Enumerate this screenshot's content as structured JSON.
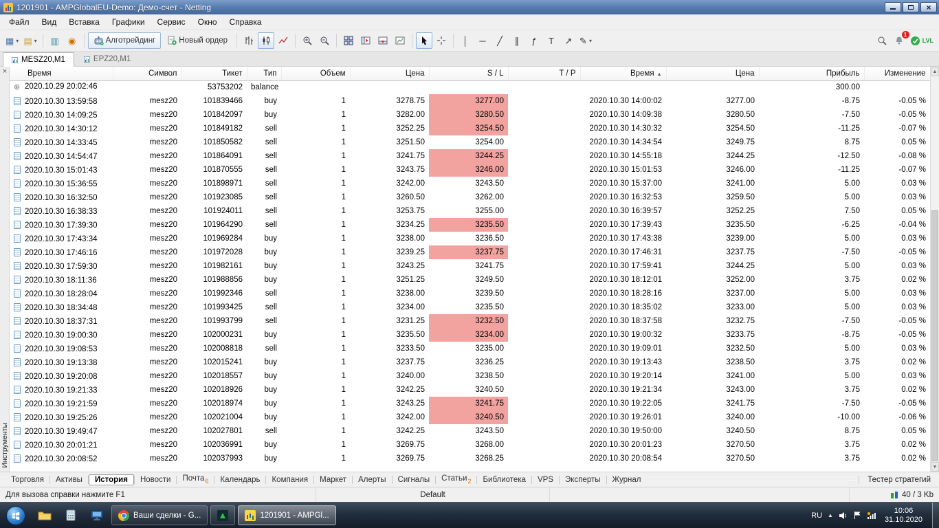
{
  "window": {
    "title": "1201901 - AMPGlobalEU-Demo: Демо-счет - Netting"
  },
  "menubar": {
    "items": [
      "Файл",
      "Вид",
      "Вставка",
      "Графики",
      "Сервис",
      "Окно",
      "Справка"
    ]
  },
  "toolbar": {
    "algo_trading_label": "Алготрейдинг",
    "new_order_label": "Новый ордер",
    "notifications_badge": "1",
    "community_label": "LVL"
  },
  "chart_tabs": {
    "active_index": 0,
    "tabs": [
      {
        "label": "MESZ20,M1"
      },
      {
        "label": "EPZ20,M1"
      }
    ]
  },
  "history": {
    "columns": [
      "Время",
      "Символ",
      "Тикет",
      "Тип",
      "Объем",
      "Цена",
      "S / L",
      "T / P",
      "Время",
      "Цена",
      "Прибыль",
      "Изменение"
    ],
    "sorted_column_index": 8,
    "rows": [
      {
        "t1": "2020.10.29 20:02:46",
        "sym": "",
        "ticket": "53753202",
        "type": "balance",
        "vol": "",
        "price": "",
        "sl": "",
        "slHit": false,
        "tp": "",
        "t2": "",
        "price2": "",
        "profit": "300.00",
        "change": ""
      },
      {
        "t1": "2020.10.30 13:59:58",
        "sym": "mesz20",
        "ticket": "101839466",
        "type": "buy",
        "vol": "1",
        "price": "3278.75",
        "sl": "3277.00",
        "slHit": true,
        "tp": "",
        "t2": "2020.10.30 14:00:02",
        "price2": "3277.00",
        "profit": "-8.75",
        "change": "-0.05 %"
      },
      {
        "t1": "2020.10.30 14:09:25",
        "sym": "mesz20",
        "ticket": "101842097",
        "type": "buy",
        "vol": "1",
        "price": "3282.00",
        "sl": "3280.50",
        "slHit": true,
        "tp": "",
        "t2": "2020.10.30 14:09:38",
        "price2": "3280.50",
        "profit": "-7.50",
        "change": "-0.05 %"
      },
      {
        "t1": "2020.10.30 14:30:12",
        "sym": "mesz20",
        "ticket": "101849182",
        "type": "sell",
        "vol": "1",
        "price": "3252.25",
        "sl": "3254.50",
        "slHit": true,
        "tp": "",
        "t2": "2020.10.30 14:30:32",
        "price2": "3254.50",
        "profit": "-11.25",
        "change": "-0.07 %"
      },
      {
        "t1": "2020.10.30 14:33:45",
        "sym": "mesz20",
        "ticket": "101850582",
        "type": "sell",
        "vol": "1",
        "price": "3251.50",
        "sl": "3254.00",
        "slHit": false,
        "tp": "",
        "t2": "2020.10.30 14:34:54",
        "price2": "3249.75",
        "profit": "8.75",
        "change": "0.05 %"
      },
      {
        "t1": "2020.10.30 14:54:47",
        "sym": "mesz20",
        "ticket": "101864091",
        "type": "sell",
        "vol": "1",
        "price": "3241.75",
        "sl": "3244.25",
        "slHit": true,
        "tp": "",
        "t2": "2020.10.30 14:55:18",
        "price2": "3244.25",
        "profit": "-12.50",
        "change": "-0.08 %"
      },
      {
        "t1": "2020.10.30 15:01:43",
        "sym": "mesz20",
        "ticket": "101870555",
        "type": "sell",
        "vol": "1",
        "price": "3243.75",
        "sl": "3246.00",
        "slHit": true,
        "tp": "",
        "t2": "2020.10.30 15:01:53",
        "price2": "3246.00",
        "profit": "-11.25",
        "change": "-0.07 %"
      },
      {
        "t1": "2020.10.30 15:36:55",
        "sym": "mesz20",
        "ticket": "101898971",
        "type": "sell",
        "vol": "1",
        "price": "3242.00",
        "sl": "3243.50",
        "slHit": false,
        "tp": "",
        "t2": "2020.10.30 15:37:00",
        "price2": "3241.00",
        "profit": "5.00",
        "change": "0.03 %"
      },
      {
        "t1": "2020.10.30 16:32:50",
        "sym": "mesz20",
        "ticket": "101923085",
        "type": "sell",
        "vol": "1",
        "price": "3260.50",
        "sl": "3262.00",
        "slHit": false,
        "tp": "",
        "t2": "2020.10.30 16:32:53",
        "price2": "3259.50",
        "profit": "5.00",
        "change": "0.03 %"
      },
      {
        "t1": "2020.10.30 16:38:33",
        "sym": "mesz20",
        "ticket": "101924011",
        "type": "sell",
        "vol": "1",
        "price": "3253.75",
        "sl": "3255.00",
        "slHit": false,
        "tp": "",
        "t2": "2020.10.30 16:39:57",
        "price2": "3252.25",
        "profit": "7.50",
        "change": "0.05 %"
      },
      {
        "t1": "2020.10.30 17:39:30",
        "sym": "mesz20",
        "ticket": "101964290",
        "type": "sell",
        "vol": "1",
        "price": "3234.25",
        "sl": "3235.50",
        "slHit": true,
        "tp": "",
        "t2": "2020.10.30 17:39:43",
        "price2": "3235.50",
        "profit": "-6.25",
        "change": "-0.04 %"
      },
      {
        "t1": "2020.10.30 17:43:34",
        "sym": "mesz20",
        "ticket": "101969284",
        "type": "buy",
        "vol": "1",
        "price": "3238.00",
        "sl": "3236.50",
        "slHit": false,
        "tp": "",
        "t2": "2020.10.30 17:43:38",
        "price2": "3239.00",
        "profit": "5.00",
        "change": "0.03 %"
      },
      {
        "t1": "2020.10.30 17:46:16",
        "sym": "mesz20",
        "ticket": "101972028",
        "type": "buy",
        "vol": "1",
        "price": "3239.25",
        "sl": "3237.75",
        "slHit": true,
        "tp": "",
        "t2": "2020.10.30 17:46:31",
        "price2": "3237.75",
        "profit": "-7.50",
        "change": "-0.05 %"
      },
      {
        "t1": "2020.10.30 17:59:30",
        "sym": "mesz20",
        "ticket": "101982161",
        "type": "buy",
        "vol": "1",
        "price": "3243.25",
        "sl": "3241.75",
        "slHit": false,
        "tp": "",
        "t2": "2020.10.30 17:59:41",
        "price2": "3244.25",
        "profit": "5.00",
        "change": "0.03 %"
      },
      {
        "t1": "2020.10.30 18:11:36",
        "sym": "mesz20",
        "ticket": "101988856",
        "type": "buy",
        "vol": "1",
        "price": "3251.25",
        "sl": "3249.50",
        "slHit": false,
        "tp": "",
        "t2": "2020.10.30 18:12:01",
        "price2": "3252.00",
        "profit": "3.75",
        "change": "0.02 %"
      },
      {
        "t1": "2020.10.30 18:28:04",
        "sym": "mesz20",
        "ticket": "101992346",
        "type": "sell",
        "vol": "1",
        "price": "3238.00",
        "sl": "3239.50",
        "slHit": false,
        "tp": "",
        "t2": "2020.10.30 18:28:16",
        "price2": "3237.00",
        "profit": "5.00",
        "change": "0.03 %"
      },
      {
        "t1": "2020.10.30 18:34:48",
        "sym": "mesz20",
        "ticket": "101993425",
        "type": "sell",
        "vol": "1",
        "price": "3234.00",
        "sl": "3235.50",
        "slHit": false,
        "tp": "",
        "t2": "2020.10.30 18:35:02",
        "price2": "3233.00",
        "profit": "5.00",
        "change": "0.03 %"
      },
      {
        "t1": "2020.10.30 18:37:31",
        "sym": "mesz20",
        "ticket": "101993799",
        "type": "sell",
        "vol": "1",
        "price": "3231.25",
        "sl": "3232.50",
        "slHit": true,
        "tp": "",
        "t2": "2020.10.30 18:37:58",
        "price2": "3232.75",
        "profit": "-7.50",
        "change": "-0.05 %"
      },
      {
        "t1": "2020.10.30 19:00:30",
        "sym": "mesz20",
        "ticket": "102000231",
        "type": "buy",
        "vol": "1",
        "price": "3235.50",
        "sl": "3234.00",
        "slHit": true,
        "tp": "",
        "t2": "2020.10.30 19:00:32",
        "price2": "3233.75",
        "profit": "-8.75",
        "change": "-0.05 %"
      },
      {
        "t1": "2020.10.30 19:08:53",
        "sym": "mesz20",
        "ticket": "102008818",
        "type": "sell",
        "vol": "1",
        "price": "3233.50",
        "sl": "3235.00",
        "slHit": false,
        "tp": "",
        "t2": "2020.10.30 19:09:01",
        "price2": "3232.50",
        "profit": "5.00",
        "change": "0.03 %"
      },
      {
        "t1": "2020.10.30 19:13:38",
        "sym": "mesz20",
        "ticket": "102015241",
        "type": "buy",
        "vol": "1",
        "price": "3237.75",
        "sl": "3236.25",
        "slHit": false,
        "tp": "",
        "t2": "2020.10.30 19:13:43",
        "price2": "3238.50",
        "profit": "3.75",
        "change": "0.02 %"
      },
      {
        "t1": "2020.10.30 19:20:08",
        "sym": "mesz20",
        "ticket": "102018557",
        "type": "buy",
        "vol": "1",
        "price": "3240.00",
        "sl": "3238.50",
        "slHit": false,
        "tp": "",
        "t2": "2020.10.30 19:20:14",
        "price2": "3241.00",
        "profit": "5.00",
        "change": "0.03 %"
      },
      {
        "t1": "2020.10.30 19:21:33",
        "sym": "mesz20",
        "ticket": "102018926",
        "type": "buy",
        "vol": "1",
        "price": "3242.25",
        "sl": "3240.50",
        "slHit": false,
        "tp": "",
        "t2": "2020.10.30 19:21:34",
        "price2": "3243.00",
        "profit": "3.75",
        "change": "0.02 %"
      },
      {
        "t1": "2020.10.30 19:21:59",
        "sym": "mesz20",
        "ticket": "102018974",
        "type": "buy",
        "vol": "1",
        "price": "3243.25",
        "sl": "3241.75",
        "slHit": true,
        "tp": "",
        "t2": "2020.10.30 19:22:05",
        "price2": "3241.75",
        "profit": "-7.50",
        "change": "-0.05 %"
      },
      {
        "t1": "2020.10.30 19:25:26",
        "sym": "mesz20",
        "ticket": "102021004",
        "type": "buy",
        "vol": "1",
        "price": "3242.00",
        "sl": "3240.50",
        "slHit": true,
        "tp": "",
        "t2": "2020.10.30 19:26:01",
        "price2": "3240.00",
        "profit": "-10.00",
        "change": "-0.06 %"
      },
      {
        "t1": "2020.10.30 19:49:47",
        "sym": "mesz20",
        "ticket": "102027801",
        "type": "sell",
        "vol": "1",
        "price": "3242.25",
        "sl": "3243.50",
        "slHit": false,
        "tp": "",
        "t2": "2020.10.30 19:50:00",
        "price2": "3240.50",
        "profit": "8.75",
        "change": "0.05 %"
      },
      {
        "t1": "2020.10.30 20:01:21",
        "sym": "mesz20",
        "ticket": "102036991",
        "type": "buy",
        "vol": "1",
        "price": "3269.75",
        "sl": "3268.00",
        "slHit": false,
        "tp": "",
        "t2": "2020.10.30 20:01:23",
        "price2": "3270.50",
        "profit": "3.75",
        "change": "0.02 %"
      },
      {
        "t1": "2020.10.30 20:08:52",
        "sym": "mesz20",
        "ticket": "102037993",
        "type": "buy",
        "vol": "1",
        "price": "3269.75",
        "sl": "3268.25",
        "slHit": false,
        "tp": "",
        "t2": "2020.10.30 20:08:54",
        "price2": "3270.50",
        "profit": "3.75",
        "change": "0.02 %"
      }
    ]
  },
  "side_strip": {
    "label": "Инструменты",
    "close": "×"
  },
  "bottom_tabs": {
    "tabs": [
      {
        "label": "Торговля"
      },
      {
        "label": "Активы"
      },
      {
        "label": "История",
        "active": true
      },
      {
        "label": "Новости"
      },
      {
        "label": "Почта",
        "badge": "6"
      },
      {
        "label": "Календарь"
      },
      {
        "label": "Компания"
      },
      {
        "label": "Маркет"
      },
      {
        "label": "Алерты"
      },
      {
        "label": "Сигналы"
      },
      {
        "label": "Статьи",
        "badge": "2"
      },
      {
        "label": "Библиотека"
      },
      {
        "label": "VPS"
      },
      {
        "label": "Эксперты"
      },
      {
        "label": "Журнал"
      }
    ],
    "right_label": "Тестер стратегий"
  },
  "statusbar": {
    "help": "Для вызова справки нажмите F1",
    "profile": "Default",
    "traffic": "40 / 3 Kb"
  },
  "taskbar": {
    "apps": [
      {
        "icon": "chrome",
        "label": "Ваши сделки - G...",
        "active": false
      },
      {
        "icon": "alpari",
        "label": "",
        "active": false
      },
      {
        "icon": "mt5",
        "label": "1201901 - AMPGl...",
        "active": true
      }
    ],
    "tray": {
      "lang": "RU",
      "time": "10:06",
      "date": "31.10.2020"
    }
  }
}
